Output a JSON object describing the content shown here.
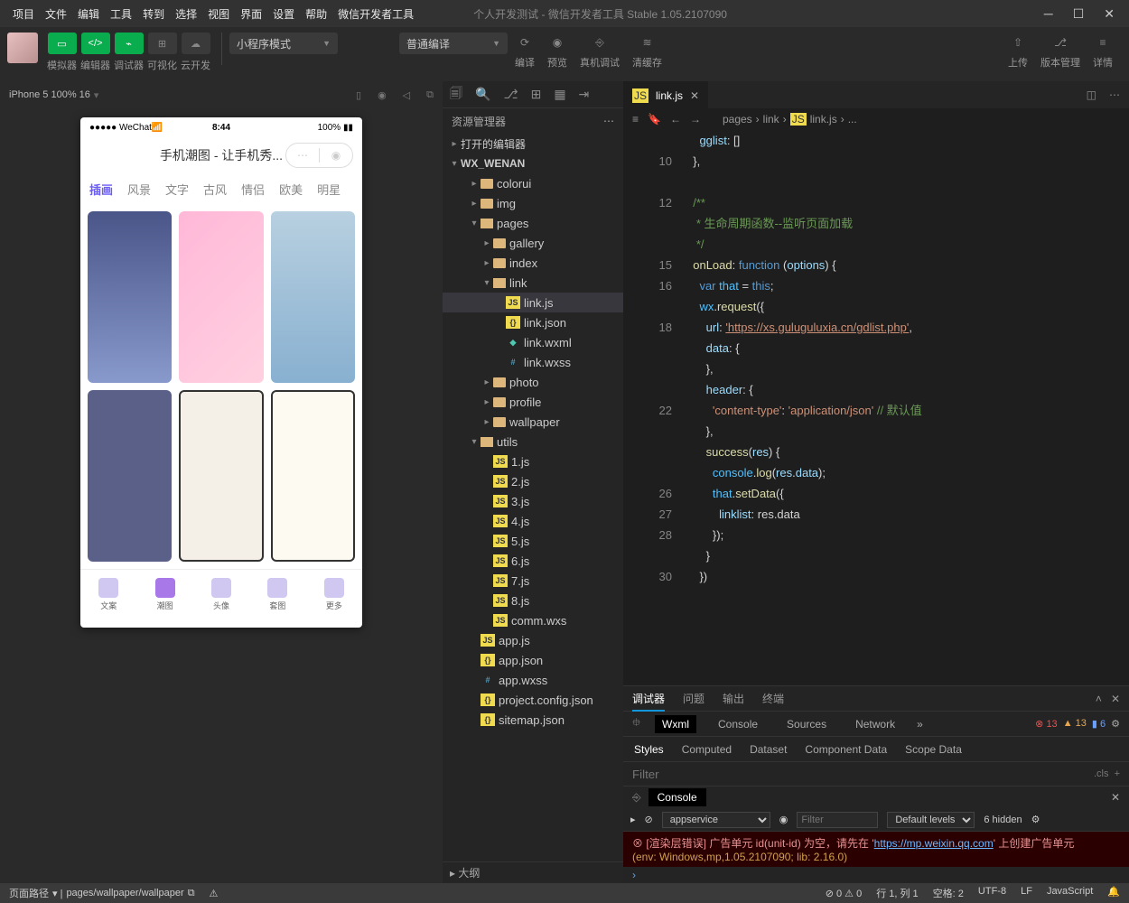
{
  "menubar": [
    "项目",
    "文件",
    "编辑",
    "工具",
    "转到",
    "选择",
    "视图",
    "界面",
    "设置",
    "帮助",
    "微信开发者工具"
  ],
  "title": "个人开发测试 - 微信开发者工具 Stable 1.05.2107090",
  "toolbar": {
    "mode_groups": [
      "模拟器",
      "编辑器",
      "调试器",
      "可视化",
      "云开发"
    ],
    "compile_mode": "小程序模式",
    "compile_type": "普通编译",
    "action_labels": [
      "编译",
      "预览",
      "真机调试",
      "清缓存"
    ],
    "right_labels": [
      "上传",
      "版本管理",
      "详情"
    ]
  },
  "simulator": {
    "device": "iPhone 5 100% 16",
    "status_left": "●●●●● WeChat",
    "time": "8:44",
    "battery": "100%",
    "app_title": "手机潮图 - 让手机秀...",
    "cats": [
      "插画",
      "风景",
      "文字",
      "古风",
      "情侣",
      "欧美",
      "明星"
    ],
    "tabbar": [
      "文案",
      "潮图",
      "头像",
      "套图",
      "更多"
    ]
  },
  "explorer": {
    "title": "资源管理器",
    "sections": {
      "opened": "打开的编辑器",
      "project": "WX_WENAN",
      "outline": "大纲"
    },
    "tree": [
      {
        "name": "colorui",
        "type": "folder",
        "indent": 2
      },
      {
        "name": "img",
        "type": "folder",
        "indent": 2
      },
      {
        "name": "pages",
        "type": "folder-open",
        "indent": 2,
        "expanded": true
      },
      {
        "name": "gallery",
        "type": "folder",
        "indent": 3
      },
      {
        "name": "index",
        "type": "folder",
        "indent": 3
      },
      {
        "name": "link",
        "type": "folder-open",
        "indent": 3,
        "expanded": true
      },
      {
        "name": "link.js",
        "type": "js",
        "indent": 4,
        "active": true
      },
      {
        "name": "link.json",
        "type": "json",
        "indent": 4
      },
      {
        "name": "link.wxml",
        "type": "wxml",
        "indent": 4
      },
      {
        "name": "link.wxss",
        "type": "wxss",
        "indent": 4
      },
      {
        "name": "photo",
        "type": "folder",
        "indent": 3
      },
      {
        "name": "profile",
        "type": "folder",
        "indent": 3
      },
      {
        "name": "wallpaper",
        "type": "folder",
        "indent": 3
      },
      {
        "name": "utils",
        "type": "folder-open",
        "indent": 2,
        "expanded": true
      },
      {
        "name": "1.js",
        "type": "js",
        "indent": 3
      },
      {
        "name": "2.js",
        "type": "js",
        "indent": 3
      },
      {
        "name": "3.js",
        "type": "js",
        "indent": 3
      },
      {
        "name": "4.js",
        "type": "js",
        "indent": 3
      },
      {
        "name": "5.js",
        "type": "js",
        "indent": 3
      },
      {
        "name": "6.js",
        "type": "js",
        "indent": 3
      },
      {
        "name": "7.js",
        "type": "js",
        "indent": 3
      },
      {
        "name": "8.js",
        "type": "js",
        "indent": 3
      },
      {
        "name": "comm.wxs",
        "type": "js",
        "indent": 3
      },
      {
        "name": "app.js",
        "type": "js",
        "indent": 2
      },
      {
        "name": "app.json",
        "type": "json",
        "indent": 2
      },
      {
        "name": "app.wxss",
        "type": "wxss",
        "indent": 2
      },
      {
        "name": "project.config.json",
        "type": "json",
        "indent": 2
      },
      {
        "name": "sitemap.json",
        "type": "json",
        "indent": 2
      }
    ]
  },
  "editor": {
    "tab": "link.js",
    "breadcrumb": [
      "pages",
      "link",
      "link.js",
      "..."
    ],
    "code_lines": [
      {
        "n": "",
        "html": "    <span class='tk-prop'>gglist</span><span class='tk-p'>: []</span>"
      },
      {
        "n": "10",
        "html": "  <span class='tk-p'>},</span>"
      },
      {
        "n": "",
        "html": ""
      },
      {
        "n": "12",
        "html": "  <span class='tk-com'>/**</span>"
      },
      {
        "n": "",
        "html": "  <span class='tk-com'> * 生命周期函数--监听页面加载</span>"
      },
      {
        "n": "",
        "html": "  <span class='tk-com'> */</span>"
      },
      {
        "n": "15",
        "html": "  <span class='tk-fn'>onLoad</span><span class='tk-p'>: </span><span class='tk-kw'>function</span> <span class='tk-p'>(</span><span class='tk-prop'>options</span><span class='tk-p'>) {</span>"
      },
      {
        "n": "16",
        "html": "    <span class='tk-kw'>var</span> <span class='tk-var'>that</span> <span class='tk-p'>= </span><span class='tk-this'>this</span><span class='tk-p'>;</span>"
      },
      {
        "n": "",
        "html": "    <span class='tk-var'>wx</span><span class='tk-p'>.</span><span class='tk-fn'>request</span><span class='tk-p'>({</span>"
      },
      {
        "n": "18",
        "html": "      <span class='tk-prop'>url</span><span class='tk-p'>: </span><span class='tk-link'>'https://xs.guluguluxia.cn/gdlist.php'</span><span class='tk-p'>,</span>"
      },
      {
        "n": "",
        "html": "      <span class='tk-prop'>data</span><span class='tk-p'>: {</span>"
      },
      {
        "n": "",
        "html": "      <span class='tk-p'>},</span>"
      },
      {
        "n": "",
        "html": "      <span class='tk-prop'>header</span><span class='tk-p'>: {</span>"
      },
      {
        "n": "22",
        "html": "        <span class='tk-str'>'content-type'</span><span class='tk-p'>: </span><span class='tk-str'>'application/json'</span> <span class='tk-com'>// 默认值</span>"
      },
      {
        "n": "",
        "html": "      <span class='tk-p'>},</span>"
      },
      {
        "n": "",
        "html": "      <span class='tk-fn'>success</span><span class='tk-p'>(</span><span class='tk-prop'>res</span><span class='tk-p'>) {</span>"
      },
      {
        "n": "",
        "html": "        <span class='tk-var'>console</span><span class='tk-p'>.</span><span class='tk-fn'>log</span><span class='tk-p'>(</span><span class='tk-prop'>res</span><span class='tk-p'>.</span><span class='tk-prop'>data</span><span class='tk-p'>);</span>"
      },
      {
        "n": "26",
        "html": "        <span class='tk-var'>that</span><span class='tk-p'>.</span><span class='tk-fn'>setData</span><span class='tk-p'>({</span>"
      },
      {
        "n": "27",
        "html": "          <span class='tk-prop'>linklist</span><span class='tk-p'>: res.data</span>"
      },
      {
        "n": "28",
        "html": "        <span class='tk-p'>});</span>"
      },
      {
        "n": "",
        "html": "      <span class='tk-p'>}</span>"
      },
      {
        "n": "30",
        "html": "    <span class='tk-p'>})</span>"
      }
    ]
  },
  "devtools": {
    "top_tabs": [
      "调试器",
      "问题",
      "输出",
      "终端"
    ],
    "sub_tabs": [
      "Wxml",
      "Console",
      "Sources",
      "Network"
    ],
    "errors": "13",
    "warnings": "13",
    "info": "6",
    "styles_tabs": [
      "Styles",
      "Computed",
      "Dataset",
      "Component Data",
      "Scope Data"
    ],
    "filter_ph": "Filter",
    "cls": ".cls"
  },
  "console": {
    "tab": "Console",
    "context": "appservice",
    "levels": "Default levels",
    "hidden": "6 hidden",
    "filter_ph": "Filter",
    "err1a": "[渲染层错误] 广告单元 id(unit-id) 为空，请先在 '",
    "err1link": "https://mp.weixin.qq.com",
    "err1b": "' 上创建广告单元",
    "err2": "(env: Windows,mp,1.05.2107090; lib: 2.16.0)"
  },
  "statusbar": {
    "route_label": "页面路径",
    "route": "pages/wallpaper/wallpaper",
    "stats": "⊘ 0 ⚠ 0",
    "pos": "行 1, 列 1",
    "spaces": "空格: 2",
    "enc": "UTF-8",
    "eol": "LF",
    "lang": "JavaScript"
  }
}
